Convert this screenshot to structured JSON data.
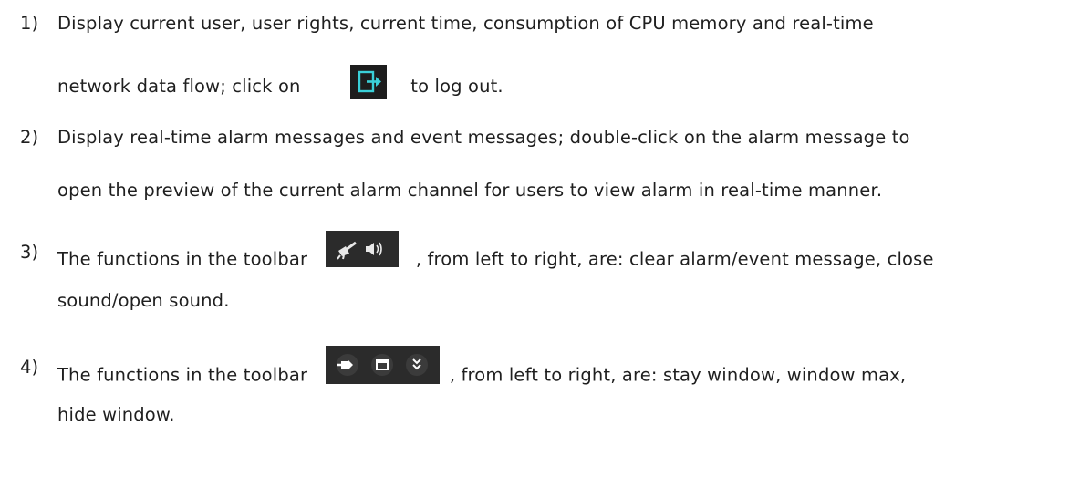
{
  "items": [
    {
      "num": "1)",
      "line1": "Display current user, user rights, current time, consumption of CPU memory and real-time",
      "line2_pre": "network data flow; click on",
      "line2_post": "to log out.",
      "icon": "logout-icon"
    },
    {
      "num": "2)",
      "line1": "Display real-time alarm messages and event messages; double-click on the alarm message to",
      "line2": "open the preview of the current alarm channel for users to view alarm in real-time manner."
    },
    {
      "num": "3)",
      "line1_pre": "The functions in the toolbar",
      "line1_post": ", from left to right, are: clear alarm/event message, close",
      "line2": "sound/open sound.",
      "icons": [
        "broom-icon",
        "speaker-icon"
      ]
    },
    {
      "num": "4)",
      "line1_pre": "The functions in the toolbar",
      "line1_post": ", from left to right, are: stay window, window max,",
      "line2": "hide window.",
      "icons": [
        "pin-icon",
        "maximize-icon",
        "hide-chevron-icon"
      ]
    }
  ],
  "colors": {
    "toolbar_bg": "#2b2b2b",
    "logout_bg": "#1d1d1d",
    "logout_accent": "#3ad0d8",
    "icon_fg": "#e8e8e8"
  }
}
